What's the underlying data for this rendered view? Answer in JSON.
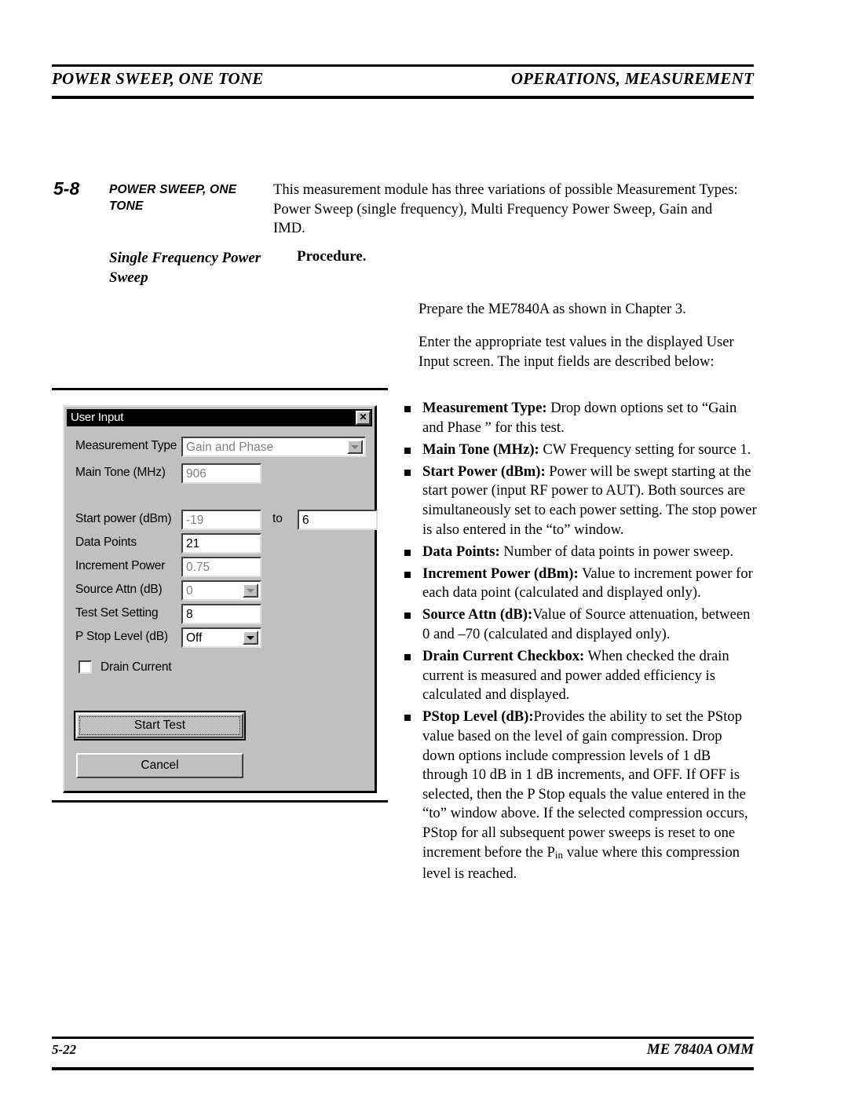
{
  "header": {
    "left": "POWER SWEEP, ONE TONE",
    "right": "OPERATIONS, MEASUREMENT"
  },
  "footer": {
    "page_number": "5-22",
    "document": "ME 7840A OMM"
  },
  "section": {
    "number": "5-8",
    "title": "POWER SWEEP, ONE TONE",
    "subtitle": "Single Frequency Power Sweep",
    "intro": "This measurement module has three variations of possible Measurement Types: Power Sweep (single frequency), Multi Frequency Power Sweep, Gain and IMD.",
    "procedure_label": "Procedure.",
    "paragraph_1": "Prepare the ME7840A as shown in Chapter 3.",
    "paragraph_2": "Enter the appropriate test values in the displayed User Input screen. The input fields are described below:"
  },
  "bullets": [
    {
      "term": "Measurement Type:",
      "text": " Drop down options set to “Gain and Phase ” for this test."
    },
    {
      "term": "Main Tone (MHz):",
      "text": " CW Frequency setting for source 1."
    },
    {
      "term": "Start Power (dBm):",
      "text": " Power will be swept starting at the start power (input RF power to AUT). Both sources are simultaneously set to each power setting. The stop power is also entered in the “to” window."
    },
    {
      "term": "Data Points:",
      "text": " Number of data points in power sweep."
    },
    {
      "term": "Increment Power (dBm):",
      "text": " Value to increment power for each data point (calculated and displayed only)."
    },
    {
      "term": "Source Attn (dB):",
      "text": "Value of Source attenuation, between 0 and –70 (calculated and displayed only)."
    },
    {
      "term": "Drain Current Checkbox:",
      "text": " When checked the drain current is measured and power added efficiency is calculated and displayed."
    },
    {
      "term": "PStop Level (dB):",
      "text": "Provides the ability to set the PStop value based on the level of gain compression. Drop down options include compression levels of 1 dB through 10 dB in 1 dB increments, and OFF. If OFF is selected, then the P Stop equals the value entered in the “to” window above. If the selected compression occurs, PStop for all subsequent power sweeps is reset to one increment before the P",
      "sub": "in",
      "text2": " value where this compression level is reached."
    }
  ],
  "dialog": {
    "title": "User Input",
    "close_glyph": "✕",
    "fields": {
      "measurement_type": {
        "label": "Measurement Type",
        "value": "Gain and Phase"
      },
      "main_tone": {
        "label": "Main Tone (MHz)",
        "value": "906"
      },
      "start_power": {
        "label": "Start power (dBm)",
        "value": "-19",
        "to_label": "to",
        "stop_value": "6"
      },
      "data_points": {
        "label": "Data Points",
        "value": "21"
      },
      "increment_power": {
        "label": "Increment Power",
        "value": "0.75"
      },
      "source_attn": {
        "label": "Source Attn (dB)",
        "value": "0"
      },
      "test_set_setting": {
        "label": "Test Set Setting",
        "value": "8"
      },
      "p_stop_level": {
        "label": "P Stop Level (dB)",
        "value": "Off"
      },
      "drain_current": {
        "label": "Drain Current",
        "checked": false
      }
    },
    "buttons": {
      "start_test": "Start Test",
      "cancel": "Cancel"
    }
  }
}
